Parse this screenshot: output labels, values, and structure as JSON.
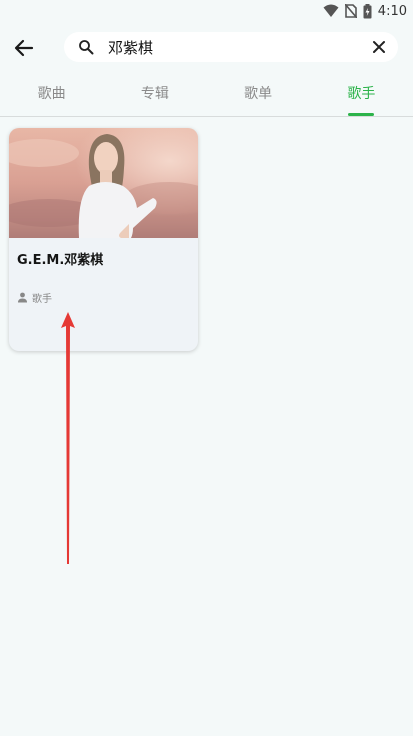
{
  "status_bar": {
    "time": "4:10",
    "icons": [
      "wifi-icon",
      "no-sim-icon",
      "battery-charging-icon"
    ]
  },
  "header": {
    "back_icon": "arrow-left-icon"
  },
  "search": {
    "value": "邓紫棋",
    "icon": "search-icon",
    "clear_icon": "close-icon"
  },
  "tabs": [
    {
      "label": "歌曲",
      "active": false
    },
    {
      "label": "专辑",
      "active": false
    },
    {
      "label": "歌单",
      "active": false
    },
    {
      "label": "歌手",
      "active": true
    }
  ],
  "accent_color": "#2cb34a",
  "results": [
    {
      "name": "G.E.M.邓紫棋",
      "type_label": "歌手",
      "type_icon": "person-icon"
    }
  ],
  "annotation": {
    "color": "#e53935",
    "shape": "arrow-up"
  }
}
